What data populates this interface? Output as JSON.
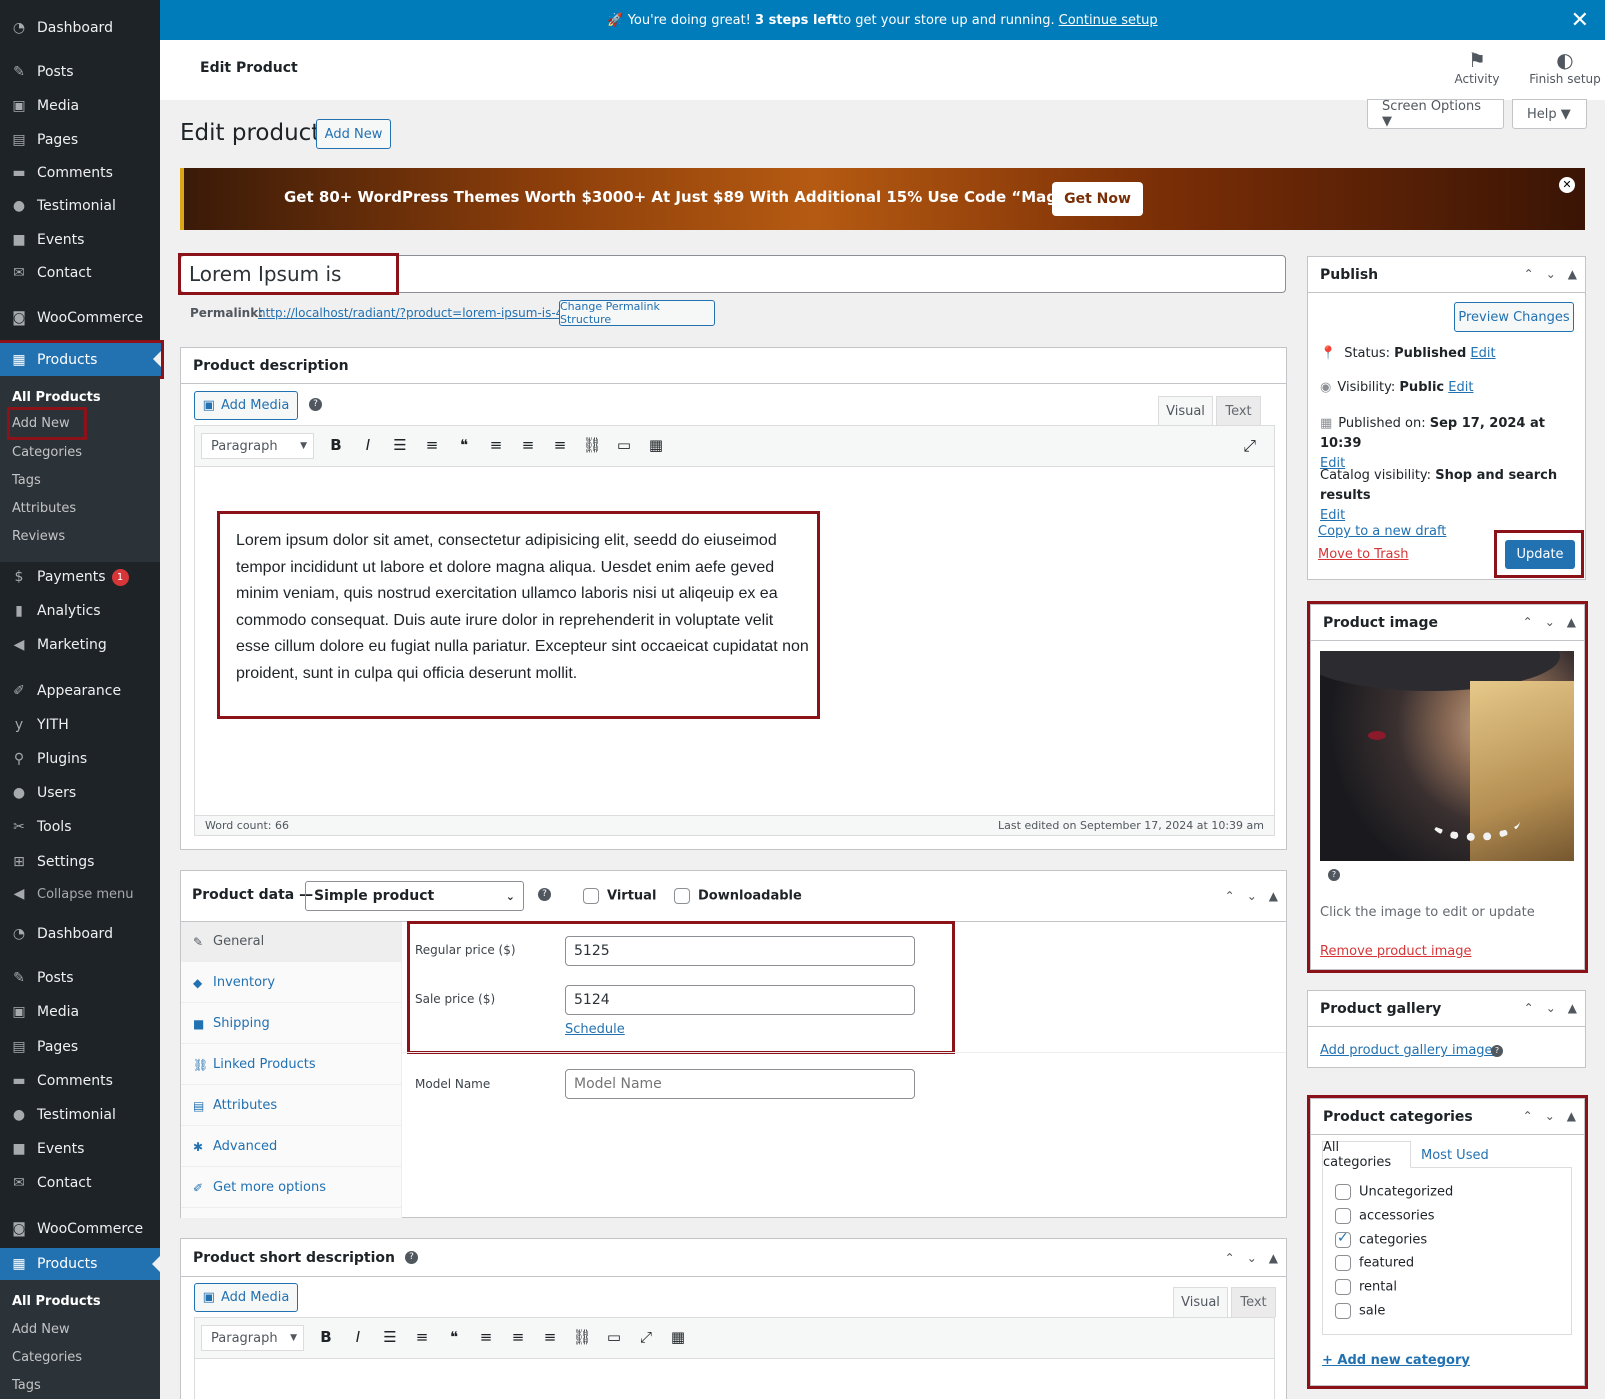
{
  "sidebar": {
    "top_items": [
      {
        "label": "Dashboard",
        "icon": "dashboard-icon"
      },
      {
        "label": "Posts",
        "icon": "pin-icon"
      },
      {
        "label": "Media",
        "icon": "media-icon"
      },
      {
        "label": "Pages",
        "icon": "pages-icon"
      },
      {
        "label": "Comments",
        "icon": "comments-icon"
      },
      {
        "label": "Testimonial",
        "icon": "user-icon"
      },
      {
        "label": "Events",
        "icon": "video-icon"
      },
      {
        "label": "Contact",
        "icon": "mail-icon"
      },
      {
        "label": "WooCommerce",
        "icon": "woo-icon"
      },
      {
        "label": "Products",
        "icon": "archive-icon"
      }
    ],
    "submenu": [
      "All Products",
      "Add New",
      "Categories",
      "Tags",
      "Attributes",
      "Reviews"
    ],
    "mid_items": [
      {
        "label": "Payments",
        "icon": "payments-icon",
        "badge": "1"
      },
      {
        "label": "Analytics",
        "icon": "chart-icon"
      },
      {
        "label": "Marketing",
        "icon": "megaphone-icon"
      },
      {
        "label": "Appearance",
        "icon": "brush-icon"
      },
      {
        "label": "YITH",
        "icon": "yith-icon"
      },
      {
        "label": "Plugins",
        "icon": "plugin-icon"
      },
      {
        "label": "Users",
        "icon": "users-icon"
      },
      {
        "label": "Tools",
        "icon": "wrench-icon"
      },
      {
        "label": "Settings",
        "icon": "settings-icon"
      },
      {
        "label": "Collapse menu",
        "icon": "collapse-icon"
      }
    ],
    "bottom_items": [
      {
        "label": "Dashboard"
      },
      {
        "label": "Posts"
      },
      {
        "label": "Media"
      },
      {
        "label": "Pages"
      },
      {
        "label": "Comments"
      },
      {
        "label": "Testimonial"
      },
      {
        "label": "Events"
      },
      {
        "label": "Contact"
      },
      {
        "label": "WooCommerce"
      },
      {
        "label": "Products"
      }
    ],
    "submenu2": [
      "All Products",
      "Add New",
      "Categories",
      "Tags"
    ]
  },
  "notice": {
    "prefix": "🚀 You're doing great! ",
    "bold": "3 steps left",
    "suffix": " to get your store up and running.",
    "link": "Continue setup"
  },
  "header": {
    "title": "Edit Product",
    "activity": "Activity",
    "finish_setup": "Finish setup"
  },
  "screen_options": "Screen Options ▼",
  "help": "Help ▼",
  "page_title": "Edit product",
  "add_new": "Add New",
  "banner": {
    "text": "Get 80+ WordPress Themes Worth $3000+ At Just $89 With Additional 15% Use Code “MagBun15”",
    "button": "Get Now"
  },
  "product_title": "Lorem Ipsum is",
  "permalink": {
    "label": "Permalink:",
    "url": "http://localhost/radiant/?product=lorem-ipsum-is-4",
    "button": "Change Permalink Structure"
  },
  "description": {
    "heading": "Product description",
    "add_media": "Add Media",
    "tab_visual": "Visual",
    "tab_text": "Text",
    "format": "Paragraph",
    "body": "Lorem ipsum dolor sit amet, consectetur adipisicing elit, seedd do eiuseimod tempor incididunt ut labore et dolore magna aliqua. Uesdet enim aefe geved minim veniam, quis nostrud exercitation ullamco laboris nisi ut aliqeuip ex ea commodo consequat. Duis aute irure dolor in reprehenderit in voluptate velit esse cillum dolore eu fugiat nulla pariatur. Excepteur sint occaeicat cupidatat non proident, sunt in culpa qui officia deserunt mollit.",
    "word_count": "Word count: 66",
    "last_edited": "Last edited on September 17, 2024 at 10:39 am"
  },
  "product_data": {
    "heading": "Product data —",
    "type": "Simple product",
    "virtual": "Virtual",
    "downloadable": "Downloadable",
    "tabs": [
      {
        "label": "General",
        "icon": "wrench-icon"
      },
      {
        "label": "Inventory",
        "icon": "tag-icon"
      },
      {
        "label": "Shipping",
        "icon": "truck-icon"
      },
      {
        "label": "Linked Products",
        "icon": "link-icon"
      },
      {
        "label": "Attributes",
        "icon": "list-icon"
      },
      {
        "label": "Advanced",
        "icon": "gear-icon"
      },
      {
        "label": "Get more options",
        "icon": "plugin-icon"
      }
    ],
    "regular_price_label": "Regular price ($)",
    "regular_price": "5125",
    "sale_price_label": "Sale price ($)",
    "sale_price": "5124",
    "schedule": "Schedule",
    "model_name_label": "Model Name",
    "model_name_placeholder": "Model Name"
  },
  "short_description": {
    "heading": "Product short description",
    "add_media": "Add Media",
    "tab_visual": "Visual",
    "tab_text": "Text",
    "format": "Paragraph"
  },
  "publish": {
    "heading": "Publish",
    "preview": "Preview Changes",
    "status_label": "Status:",
    "status": "Published",
    "visibility_label": "Visibility:",
    "visibility": "Public",
    "published_label": "Published on:",
    "published": "Sep 17, 2024 at 10:39",
    "catalog_label": "Catalog visibility:",
    "catalog": "Shop and search results",
    "edit": "Edit",
    "copy_draft": "Copy to a new draft",
    "trash": "Move to Trash",
    "update": "Update"
  },
  "product_image": {
    "heading": "Product image",
    "hint": "Click the image to edit or update",
    "remove": "Remove product image"
  },
  "gallery": {
    "heading": "Product gallery",
    "add": "Add product gallery images"
  },
  "categories": {
    "heading": "Product categories",
    "tab_all": "All categories",
    "tab_used": "Most Used",
    "items": [
      {
        "label": "Uncategorized",
        "checked": false
      },
      {
        "label": "accessories",
        "checked": false
      },
      {
        "label": "categories",
        "checked": true
      },
      {
        "label": "featured",
        "checked": false
      },
      {
        "label": "rental",
        "checked": false
      },
      {
        "label": "sale",
        "checked": false
      }
    ],
    "add_new": "+ Add new category"
  },
  "colors": {
    "admin_bar": "#1d2327",
    "accent": "#2271b1",
    "notice": "#007cba",
    "highlight": "#8b1219",
    "danger": "#d63638"
  }
}
